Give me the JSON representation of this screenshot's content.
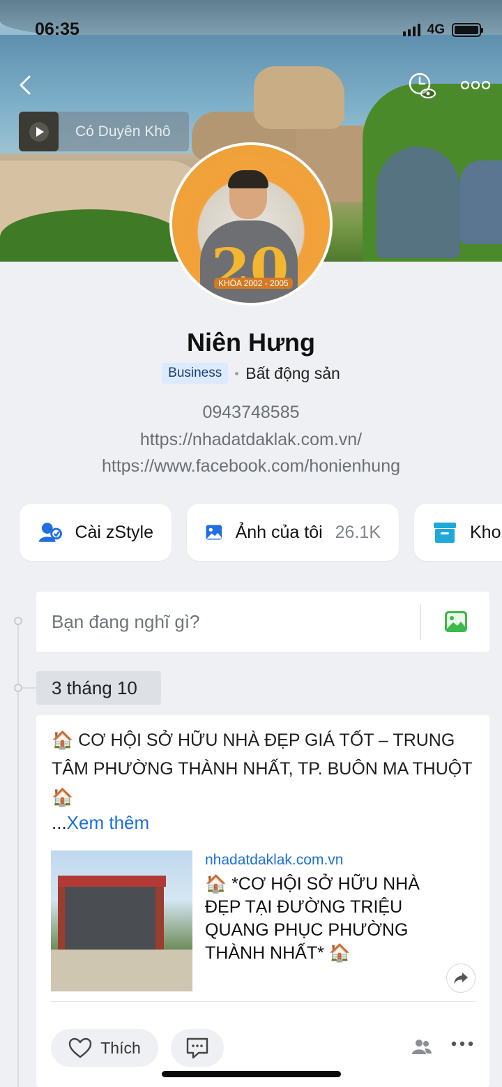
{
  "status_bar": {
    "time": "06:35",
    "network": "4G"
  },
  "cover": {
    "music_title": "Có Duyên Khô"
  },
  "profile": {
    "name": "Niên Hưng",
    "badge": "Business",
    "category": "Bất động sản",
    "phone": "0943748585",
    "website": "https://nhadatdaklak.com.vn/",
    "facebook": "https://www.facebook.com/honienhung",
    "avatar_text": "20",
    "avatar_caption": "KHÓA 2002 - 2005"
  },
  "quick_actions": [
    {
      "label": "Cài zStyle",
      "icon": "zstyle-icon"
    },
    {
      "label": "Ảnh của tôi",
      "count": "26.1K",
      "icon": "photo-icon"
    },
    {
      "label": "Kho",
      "icon": "storage-icon"
    }
  ],
  "composer": {
    "placeholder": "Bạn đang nghĩ gì?"
  },
  "timeline": {
    "date": "3 tháng 10"
  },
  "post": {
    "text": "🏠 CƠ HỘI SỞ HỮU NHÀ ĐẸP GIÁ TỐT – TRUNG TÂM PHƯỜNG THÀNH NHẤT, TP. BUÔN MA THUỘT 🏠",
    "see_more_prefix": "...",
    "see_more": "Xem thêm",
    "link_domain": "nhadatdaklak.com.vn",
    "link_title": "🏠 *CƠ HỘI SỞ HỮU NHÀ ĐẸP TẠI ĐƯỜNG TRIỆU QUANG PHỤC PHƯỜNG THÀNH NHẤT* 🏠",
    "like_label": "Thích"
  },
  "colors": {
    "accent": "#1c6fd6",
    "background": "#eef0f4",
    "badge_bg": "#dbeafd"
  }
}
